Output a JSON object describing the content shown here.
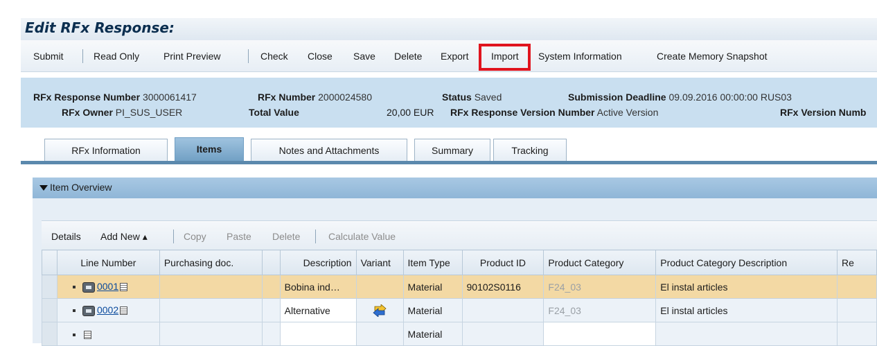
{
  "window": {
    "title": "Edit RFx Response:"
  },
  "toolbar": {
    "submit": "Submit",
    "read_only": "Read Only",
    "print_preview": "Print Preview",
    "check": "Check",
    "close": "Close",
    "save": "Save",
    "delete": "Delete",
    "export": "Export",
    "import": "Import",
    "system_information": "System Information",
    "create_memory_snapshot": "Create Memory Snapshot"
  },
  "header": {
    "response_number_label": "RFx Response Number",
    "response_number": "3000061417",
    "rfx_number_label": "RFx Number",
    "rfx_number": "2000024580",
    "status_label": "Status",
    "status": "Saved",
    "deadline_label": "Submission Deadline",
    "deadline": "09.09.2016 00:00:00 RUS03",
    "owner_label": "RFx Owner",
    "owner": "PI_SUS_USER",
    "total_value_label": "Total Value",
    "total_value": "20,00 EUR",
    "response_version_label": "RFx Response Version Number",
    "response_version": "Active Version",
    "rfx_version_label": "RFx Version Numb"
  },
  "tabs": [
    {
      "label": "RFx Information",
      "active": false
    },
    {
      "label": "Items",
      "active": true
    },
    {
      "label": "Notes and Attachments",
      "active": false
    },
    {
      "label": "Summary",
      "active": false
    },
    {
      "label": "Tracking",
      "active": false
    }
  ],
  "section": {
    "title": "Item Overview"
  },
  "table_toolbar": {
    "details": "Details",
    "add_new": "Add New ▴",
    "copy": "Copy",
    "paste": "Paste",
    "delete": "Delete",
    "calculate_value": "Calculate Value"
  },
  "table": {
    "columns": [
      "Line Number",
      "Purchasing doc.",
      "",
      "Description",
      "Variant",
      "Item Type",
      "Product ID",
      "Product Category",
      "Product Category Description",
      "Re"
    ],
    "rows": [
      {
        "line": "0001",
        "description": "Bobina ind…",
        "item_type": "Material",
        "product_id": "90102S0116",
        "category": "F24_03",
        "category_desc": "El instal articles"
      },
      {
        "line": "0002",
        "description": "Alternative",
        "item_type": "Material",
        "product_id": "",
        "category": "F24_03",
        "category_desc": "El instal articles"
      },
      {
        "line": "",
        "description": "",
        "item_type": "Material",
        "product_id": "",
        "category": "",
        "category_desc": ""
      }
    ]
  },
  "colors": {
    "highlight": "#e0141e",
    "header_bg": "#c9dff0",
    "selected_row": "#f3d9a4"
  }
}
